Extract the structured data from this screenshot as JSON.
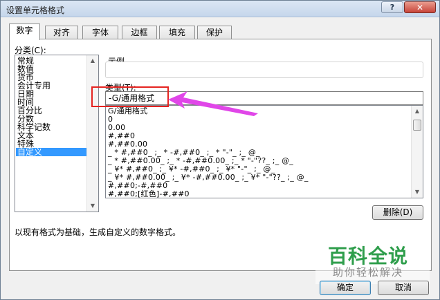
{
  "window": {
    "title": "设置单元格格式",
    "help_label": "?",
    "close_label": "✕"
  },
  "tabs": [
    {
      "label": "数字",
      "active": true
    },
    {
      "label": "对齐",
      "active": false
    },
    {
      "label": "字体",
      "active": false
    },
    {
      "label": "边框",
      "active": false
    },
    {
      "label": "填充",
      "active": false
    },
    {
      "label": "保护",
      "active": false
    }
  ],
  "category": {
    "label": "分类(C):",
    "items": [
      "常规",
      "数值",
      "货币",
      "会计专用",
      "日期",
      "时间",
      "百分比",
      "分数",
      "科学记数",
      "文本",
      "特殊",
      "自定义"
    ],
    "selected": "自定义"
  },
  "sample": {
    "label": "示例"
  },
  "type": {
    "label": "类型(T):",
    "value": "-G/通用格式"
  },
  "formats": {
    "items": [
      "G/通用格式",
      "0",
      "0.00",
      "#,##0",
      "#,##0.00",
      "_ * #,##0_ ;_ * -#,##0_ ;_ * \"-\"_ ;_ @_",
      "_ * #,##0.00_ ;_ * -#,##0.00_ ;_ * \"-\"??_ ;_ @_",
      "_ ¥* #,##0_ ;_ ¥* -#,##0_ ;_ ¥* \"-\"_ ;_ @_",
      "_ ¥* #,##0.00_ ;_ ¥* -#,##0.00_ ;_ ¥* \"-\"??_ ;_ @_",
      "#,##0;-#,##0",
      "#,##0;[红色]-#,##0"
    ]
  },
  "buttons": {
    "delete_label": "删除(D)",
    "ok_label": "确定",
    "cancel_label": "取消"
  },
  "hint": "以现有格式为基础，生成自定义的数字格式。",
  "watermark": {
    "main": "百科全说",
    "sub": "助你轻松解决"
  },
  "colors": {
    "annotation_red": "#e52320",
    "annotation_arrow": "#e046e8",
    "selection": "#3399ff",
    "watermark_green": "#2f9e4c"
  }
}
